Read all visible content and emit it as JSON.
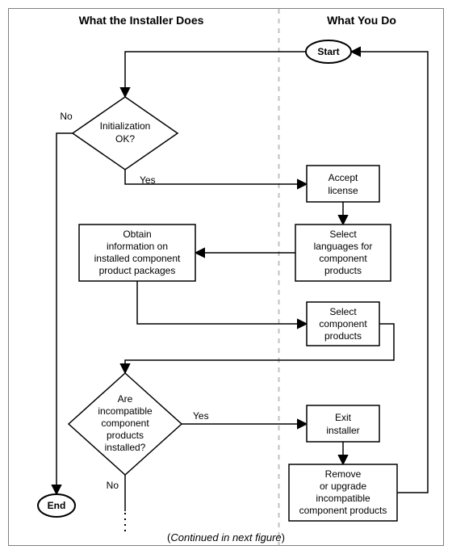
{
  "headers": {
    "left": "What the Installer Does",
    "right": "What You Do"
  },
  "nodes": {
    "start": "Start",
    "end": "End",
    "init_ok_l1": "Initialization",
    "init_ok_l2": "OK?",
    "accept_l1": "Accept",
    "accept_l2": "license",
    "select_lang_l1": "Select",
    "select_lang_l2": "languages for",
    "select_lang_l3": "component",
    "select_lang_l4": "products",
    "obtain_l1": "Obtain",
    "obtain_l2": "information on",
    "obtain_l3": "installed component",
    "obtain_l4": "product packages",
    "select_comp_l1": "Select",
    "select_comp_l2": "component",
    "select_comp_l3": "products",
    "incompat_l1": "Are",
    "incompat_l2": "incompatible",
    "incompat_l3": "component",
    "incompat_l4": "products",
    "incompat_l5": "installed?",
    "exit_l1": "Exit",
    "exit_l2": "installer",
    "remove_l1": "Remove",
    "remove_l2": "or upgrade",
    "remove_l3": "incompatible",
    "remove_l4": "component products"
  },
  "labels": {
    "no": "No",
    "yes": "Yes"
  },
  "footer": {
    "open": "(",
    "text": "Continued in next figure",
    "close": ")"
  }
}
